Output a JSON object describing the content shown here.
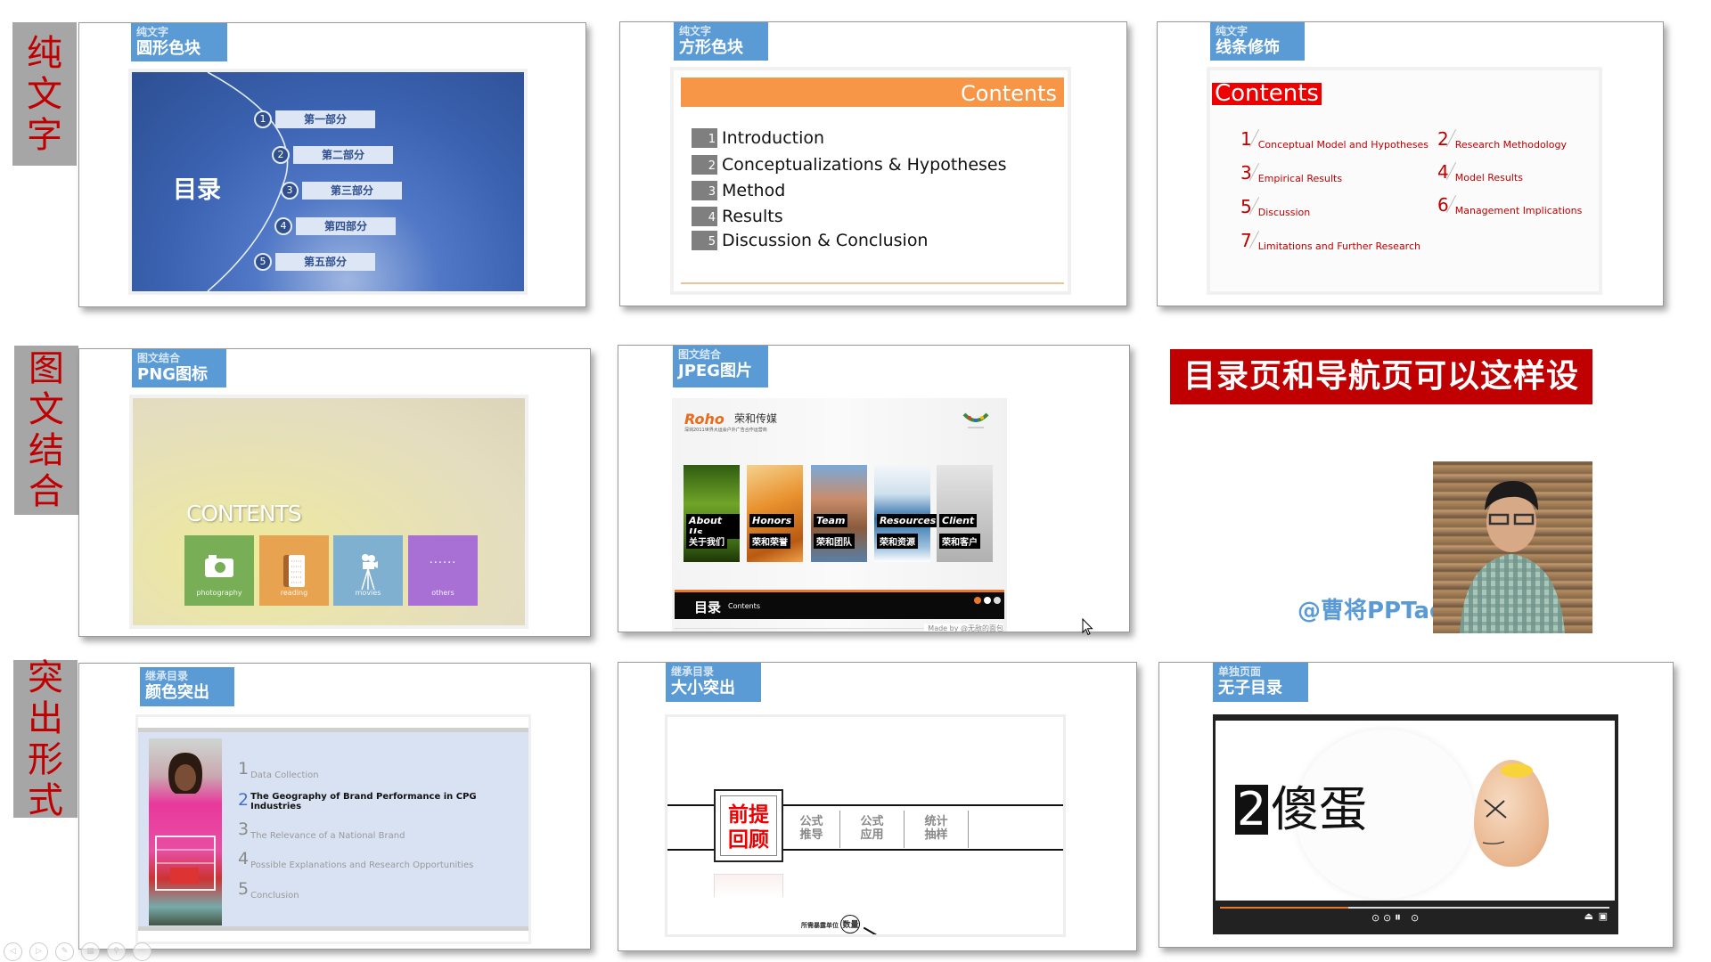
{
  "side_tabs": [
    {
      "label": [
        "纯",
        "文",
        "字"
      ]
    },
    {
      "label": [
        "图",
        "文",
        "结",
        "合"
      ]
    },
    {
      "label": [
        "突",
        "出",
        "形",
        "式"
      ]
    }
  ],
  "cards": {
    "round_blocks": {
      "tag_category": "纯文字",
      "tag_title": "圆形色块",
      "slide_title": "目录",
      "items": [
        {
          "num": "1",
          "label": "第一部分"
        },
        {
          "num": "2",
          "label": "第二部分"
        },
        {
          "num": "3",
          "label": "第三部分"
        },
        {
          "num": "4",
          "label": "第四部分"
        },
        {
          "num": "5",
          "label": "第五部分"
        }
      ]
    },
    "square_blocks": {
      "tag_category": "纯文字",
      "tag_title": "方形色块",
      "header": "Contents",
      "items": [
        {
          "num": "1",
          "label": "Introduction"
        },
        {
          "num": "2",
          "label": "Conceptualizations & Hypotheses"
        },
        {
          "num": "3",
          "label": "Method"
        },
        {
          "num": "4",
          "label": "Results"
        },
        {
          "num": "5",
          "label": "Discussion & Conclusion"
        }
      ]
    },
    "line_decor": {
      "tag_category": "纯文字",
      "tag_title": "线条修饰",
      "header": "Contents",
      "items": [
        {
          "num": "1",
          "label": "Conceptual Model and Hypotheses"
        },
        {
          "num": "2",
          "label": "Research Methodology"
        },
        {
          "num": "3",
          "label": "Empirical Results"
        },
        {
          "num": "4",
          "label": "Model Results"
        },
        {
          "num": "5",
          "label": "Discussion"
        },
        {
          "num": "6",
          "label": "Management Implications"
        },
        {
          "num": "7",
          "label": "Limitations and Further Research"
        }
      ]
    },
    "png_icons": {
      "tag_category": "图文结合",
      "tag_title": "PNG图标",
      "header": "CONTENTS",
      "tiles": [
        {
          "label": "photography",
          "icon": "camera-icon",
          "color": "#78ae56"
        },
        {
          "label": "reading",
          "icon": "book-icon",
          "color": "#e7a34f"
        },
        {
          "label": "movies",
          "icon": "film-camera-icon",
          "color": "#7fb0cf"
        },
        {
          "label": "others",
          "icon": "more-dots-icon",
          "color": "#a86fd4"
        }
      ]
    },
    "jpeg_images": {
      "tag_category": "图文结合",
      "tag_title": "JPEG图片",
      "brand": "Roho",
      "brand_cn": "荣和传媒",
      "brand_sub": "深圳2011世界大运会户外广告合作运营商",
      "tiles": [
        {
          "en": "About Us",
          "cn": "关于我们",
          "bg": "linear-gradient(180deg,#2f5c12,#6fa428 40%,#3c6b14 80%,#1d3508)"
        },
        {
          "en": "Honors",
          "cn": "荣和荣誉",
          "bg": "linear-gradient(160deg,#f4d28f,#e9922f 40%,#b85a13 80%,#f0a34a)"
        },
        {
          "en": "Team",
          "cn": "荣和团队",
          "bg": "linear-gradient(180deg,#7aa9d8,#c98d6b 35%,#8a5b3c 65%,#5a7fa7)"
        },
        {
          "en": "Resources",
          "cn": "荣和资源",
          "bg": "linear-gradient(180deg,#f4f7fa,#cfe0ee 30%,#2e6fa9 55%,#9ec2de 85%,#ffffff)"
        },
        {
          "en": "Client",
          "cn": "荣和客户",
          "bg": "linear-gradient(180deg,#e5e5e5,#cfcfcf 40%,#b0b0b0 100%)"
        }
      ],
      "footer_cn": "目录",
      "footer_en": "Contents",
      "page_dots": [
        "#e8782a",
        "#ffffff",
        "#dddddd"
      ],
      "made_by": "Made by @无敌的面包"
    },
    "color_highlight": {
      "tag_category": "继承目录",
      "tag_title": "颜色突出",
      "items": [
        {
          "num": "1",
          "label": "Data Collection",
          "active": false
        },
        {
          "num": "2",
          "label": "The Geography of Brand Performance in CPG Industries",
          "active": true
        },
        {
          "num": "3",
          "label": "The Relevance of a National Brand",
          "active": false
        },
        {
          "num": "4",
          "label": "Possible Explanations and Research Opportunities",
          "active": false
        },
        {
          "num": "5",
          "label": "Conclusion",
          "active": false
        }
      ]
    },
    "size_highlight": {
      "tag_category": "继承目录",
      "tag_title": "大小突出",
      "active_line1": "前提",
      "active_line2": "回顾",
      "cells": [
        {
          "line1": "公式",
          "line2": "推导"
        },
        {
          "line1": "公式",
          "line2": "应用"
        },
        {
          "line1": "统计",
          "line2": "抽样"
        }
      ],
      "caption": "所需暴露单位",
      "caption_circle": "数量"
    },
    "no_sub_toc": {
      "tag_category": "单独页面",
      "tag_title": "无子目录",
      "number": "2",
      "title": "傻蛋",
      "progress_percent": 33
    }
  },
  "banner": {
    "title": "目录页和导航页可以这样设计",
    "handle": "@曹将PPTao"
  },
  "toolbar": {
    "buttons": [
      {
        "name": "previous-slide-button",
        "glyph": "◁"
      },
      {
        "name": "next-slide-button",
        "glyph": "▷"
      },
      {
        "name": "pen-button",
        "glyph": "✎"
      },
      {
        "name": "slides-grid-button",
        "glyph": "▦"
      },
      {
        "name": "zoom-button",
        "glyph": "⚲"
      },
      {
        "name": "more-options-button",
        "glyph": "···"
      }
    ]
  },
  "colors": {
    "tag_blue": "#5b9bd5",
    "accent_red": "#c00000",
    "side_tab_gray": "#a6a6a6",
    "orange": "#f79646"
  }
}
